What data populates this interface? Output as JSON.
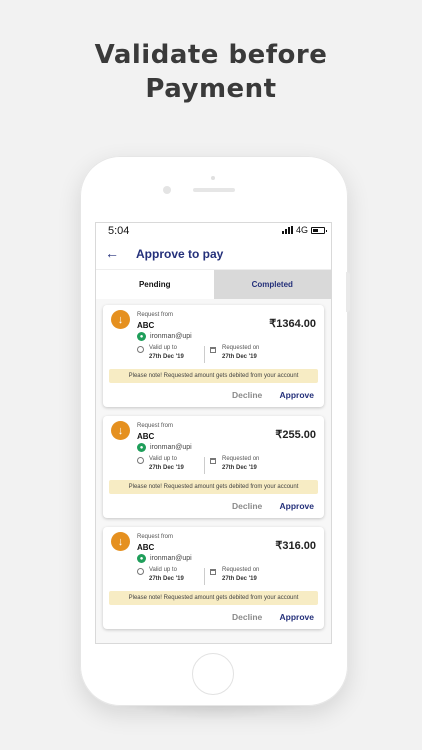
{
  "headline": {
    "line1": "Validate before",
    "line2": "Payment"
  },
  "status_bar": {
    "time": "5:04",
    "network": "4G"
  },
  "appbar": {
    "back_icon": "arrow-left-icon",
    "title": "Approve to pay"
  },
  "tabs": [
    {
      "label": "Pending",
      "active": true
    },
    {
      "label": "Completed",
      "active": false
    }
  ],
  "requests": [
    {
      "request_label": "Request from",
      "name": "ABC",
      "upi": "ironman@upi",
      "amount": "₹1364.00",
      "valid_label": "Valid up to",
      "valid_date": "27th Dec '19",
      "requested_label": "Requested on",
      "requested_date": "27th Dec '19",
      "note": "Please note! Requested amount gets debited from your account",
      "decline_label": "Decline",
      "approve_label": "Approve"
    },
    {
      "request_label": "Request from",
      "name": "ABC",
      "upi": "ironman@upi",
      "amount": "₹255.00",
      "valid_label": "Valid up to",
      "valid_date": "27th Dec '19",
      "requested_label": "Requested on",
      "requested_date": "27th Dec '19",
      "note": "Please note! Requested amount gets debited from your account",
      "decline_label": "Decline",
      "approve_label": "Approve"
    },
    {
      "request_label": "Request from",
      "name": "ABC",
      "upi": "ironman@upi",
      "amount": "₹316.00",
      "valid_label": "Valid up to",
      "valid_date": "27th Dec '19",
      "requested_label": "Requested on",
      "requested_date": "27th Dec '19",
      "note": "Please note! Requested amount gets debited from your account",
      "decline_label": "Decline",
      "approve_label": "Approve"
    }
  ],
  "colors": {
    "primary": "#24307a",
    "accent_orange": "#e5901f",
    "upi_green": "#1f9e5a",
    "note_bg": "#f7ecc4"
  }
}
